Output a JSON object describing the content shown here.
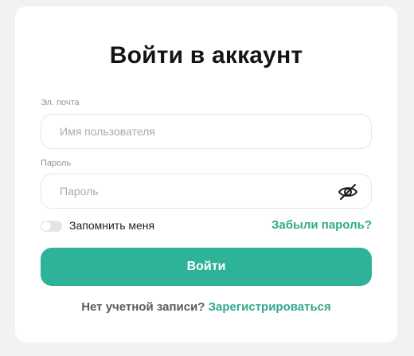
{
  "login_card": {
    "title": "Войти в аккаунт",
    "email": {
      "label": "Эл. почта",
      "value": "",
      "placeholder": "Имя пользователя"
    },
    "password": {
      "label": "Пароль",
      "value": "",
      "placeholder": "Пароль",
      "visibility_icon": "eye-slash-icon"
    },
    "remember_me": {
      "label": "Запомнить меня",
      "checked": false
    },
    "forgot_password_link": "Забыли пароль?",
    "submit_label": "Войти",
    "signup": {
      "question": "Нет учетной записи?",
      "link": "Зарегистрироваться"
    }
  },
  "colors": {
    "accent": "#2eb398",
    "link": "#34a88c",
    "page_background": "#f2f2f4",
    "card_background": "#ffffff"
  }
}
